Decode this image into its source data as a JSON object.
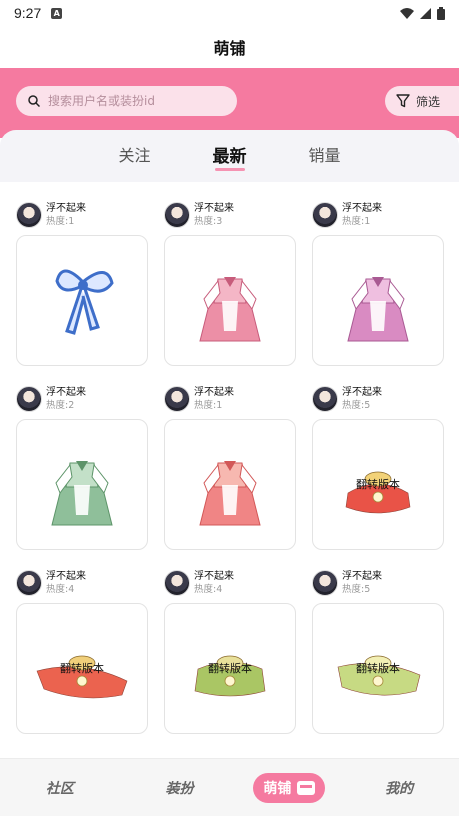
{
  "status_bar": {
    "time": "9:27",
    "notification_badge": "A"
  },
  "title": "萌铺",
  "search": {
    "placeholder": "搜索用户名或装扮id",
    "value": ""
  },
  "filter": {
    "label": "筛选"
  },
  "tabs": [
    {
      "label": "关注",
      "active": false
    },
    {
      "label": "最新",
      "active": true
    },
    {
      "label": "销量",
      "active": false
    }
  ],
  "items": [
    {
      "username": "浮不起来",
      "heat": "热度:1",
      "image": "blue-bow",
      "flip_label": ""
    },
    {
      "username": "浮不起来",
      "heat": "热度:3",
      "image": "pink-maid-dress",
      "flip_label": ""
    },
    {
      "username": "浮不起来",
      "heat": "热度:1",
      "image": "purple-maid-dress",
      "flip_label": ""
    },
    {
      "username": "浮不起来",
      "heat": "热度:2",
      "image": "green-maid-dress",
      "flip_label": ""
    },
    {
      "username": "浮不起来",
      "heat": "热度:1",
      "image": "red-maid-dress",
      "flip_label": ""
    },
    {
      "username": "浮不起来",
      "heat": "热度:5",
      "image": "red-skirt",
      "flip_label": "翻转版本"
    },
    {
      "username": "浮不起来",
      "heat": "热度:4",
      "image": "red-wide-skirt",
      "flip_label": "翻转版本"
    },
    {
      "username": "浮不起来",
      "heat": "热度:4",
      "image": "green-skirt",
      "flip_label": "翻转版本"
    },
    {
      "username": "浮不起来",
      "heat": "热度:5",
      "image": "lime-skirt",
      "flip_label": "翻转版本"
    }
  ],
  "bottom_nav": [
    {
      "label": "社区",
      "active": false
    },
    {
      "label": "装扮",
      "active": false
    },
    {
      "label": "萌铺",
      "active": true
    },
    {
      "label": "我的",
      "active": false
    }
  ],
  "colors": {
    "accent": "#f57aa0",
    "search_bg": "#fbe1ea",
    "tabs_bg": "#f4f4f8"
  }
}
